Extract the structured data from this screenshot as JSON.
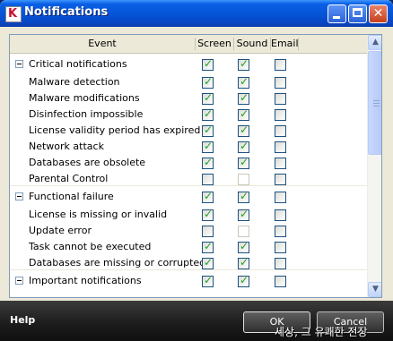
{
  "window": {
    "title": "Notifications",
    "icon": "kaspersky-k-icon",
    "icon_letter": "K"
  },
  "titlebar_buttons": {
    "minimize": "minimize-icon",
    "maximize": "maximize-icon",
    "close": "close-icon",
    "close_glyph": "✕"
  },
  "table": {
    "headers": {
      "event": "Event",
      "screen": "Screen",
      "sound": "Sound",
      "email": "Email"
    },
    "rows": [
      {
        "kind": "group",
        "label": "Critical notifications",
        "screen": true,
        "sound": true,
        "email": false
      },
      {
        "kind": "item",
        "label": "Malware detection",
        "screen": true,
        "sound": true,
        "email": false
      },
      {
        "kind": "item",
        "label": "Malware modifications",
        "screen": true,
        "sound": true,
        "email": false
      },
      {
        "kind": "item",
        "label": "Disinfection impossible",
        "screen": true,
        "sound": true,
        "email": false
      },
      {
        "kind": "item",
        "label": "License validity period has expired",
        "screen": true,
        "sound": true,
        "email": false
      },
      {
        "kind": "item",
        "label": "Network attack",
        "screen": true,
        "sound": true,
        "email": false
      },
      {
        "kind": "item",
        "label": "Databases are obsolete",
        "screen": true,
        "sound": true,
        "email": false
      },
      {
        "kind": "item",
        "label": "Parental Control",
        "screen": false,
        "sound": null,
        "email": false
      },
      {
        "kind": "group",
        "label": "Functional failure",
        "screen": true,
        "sound": true,
        "email": false
      },
      {
        "kind": "item",
        "label": "License is missing or invalid",
        "screen": true,
        "sound": true,
        "email": false
      },
      {
        "kind": "item",
        "label": "Update error",
        "screen": false,
        "sound": null,
        "email": false
      },
      {
        "kind": "item",
        "label": "Task cannot be executed",
        "screen": true,
        "sound": true,
        "email": false
      },
      {
        "kind": "item",
        "label": "Databases are missing or corrupted",
        "screen": true,
        "sound": true,
        "email": false
      },
      {
        "kind": "group",
        "label": "Important notifications",
        "screen": true,
        "sound": true,
        "email": false
      }
    ]
  },
  "scrollbar": {
    "up": "▲",
    "down": "▼"
  },
  "footer": {
    "help": "Help",
    "ok": "OK",
    "cancel": "Cancel"
  },
  "overlay": {
    "text": "세상, 그 유쾌한 전장"
  },
  "colors": {
    "check": "#21a121",
    "titlebar": "#0553d6",
    "footer": "#1b1b1b"
  }
}
